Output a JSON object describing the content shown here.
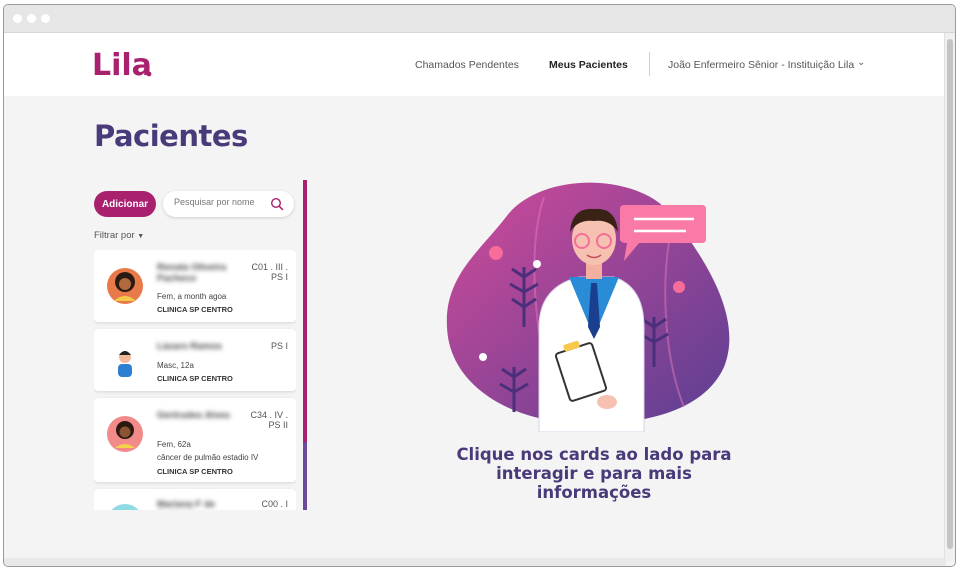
{
  "app": {
    "logo_text": "Lila"
  },
  "nav": {
    "pending": "Chamados Pendentes",
    "my_patients": "Meus Pacientes"
  },
  "user_menu": {
    "label": "João Enfermeiro Sênior - Instituição Lila"
  },
  "page": {
    "title": "Pacientes"
  },
  "toolbar": {
    "add_label": "Adicionar",
    "search_placeholder": "Pesquisar por nome",
    "filter_label": "Filtrar por"
  },
  "patients": [
    {
      "name": "Renata Oliveira Pacheco",
      "code": "C01 . III . PS I",
      "info": "Fem, a month agoa",
      "clinic": "CLINICA SP CENTRO"
    },
    {
      "name": "Lázaro Ramos",
      "code": "PS I",
      "info": "Masc, 12a",
      "clinic": "CLINICA SP CENTRO"
    },
    {
      "name": "Gertrudes Alves",
      "code": "C34 . IV . PS II",
      "info": "Fem, 62a",
      "diagnosis": "câncer de pulmão estadio IV",
      "clinic": "CLINICA SP CENTRO"
    },
    {
      "name": "Mariana F de Andrade",
      "code": "C00 . I"
    }
  ],
  "empty_state": {
    "message": "Clique nos cards ao lado para interagir e para mais informações"
  },
  "colors": {
    "primary": "#a8206e",
    "title": "#4a3a7a",
    "accent_purple": "#6a4a9a"
  }
}
